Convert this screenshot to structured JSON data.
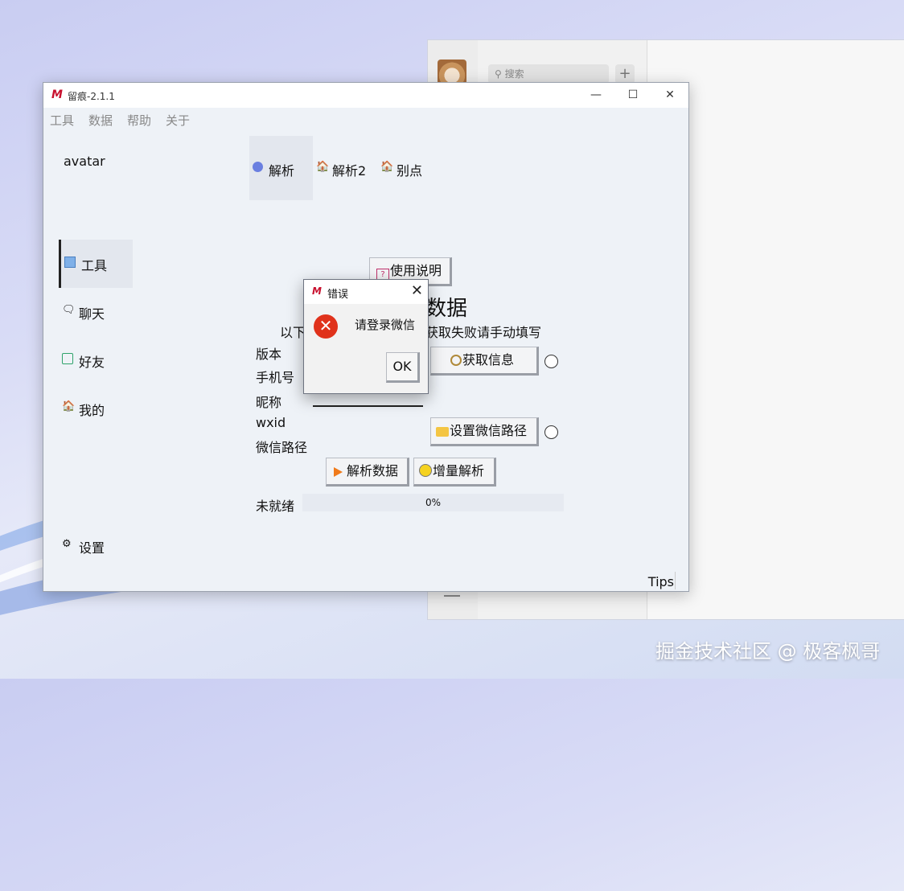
{
  "background_window": {
    "search_placeholder": "搜索",
    "add_label": "+"
  },
  "app": {
    "title": "留痕-2.1.1",
    "logo_letter": "M",
    "window_controls": {
      "minimize": "—",
      "maximize": "☐",
      "close": "✕"
    },
    "menu": [
      "工具",
      "数据",
      "帮助",
      "关于"
    ],
    "avatar_text": "avatar",
    "nav": [
      {
        "label": "工具",
        "icon": "toolbox-icon",
        "active": true
      },
      {
        "label": "聊天",
        "icon": "chat-bubble-icon",
        "active": false
      },
      {
        "label": "好友",
        "icon": "contact-icon",
        "active": false
      },
      {
        "label": "我的",
        "icon": "house-icon",
        "active": false
      },
      {
        "label": "设置",
        "icon": "gear-icon",
        "active": false
      }
    ],
    "tabs": [
      {
        "label": "解析",
        "icon": "blue-dot-icon",
        "active": true
      },
      {
        "label": "解析2",
        "icon": "house-icon",
        "active": false
      },
      {
        "label": "别点",
        "icon": "house-icon",
        "active": false
      }
    ],
    "help_button": "使用说明",
    "partial_heading": "数据",
    "partial_info_left": "以下",
    "partial_info_right": "获取失败请手动填写",
    "fields": [
      "版本",
      "手机号",
      "昵称",
      "wxid",
      "微信路径"
    ],
    "get_info_button": "获取信息",
    "set_path_button": "设置微信路径",
    "parse_button": "解析数据",
    "incremental_button": "增量解析",
    "status": "未就绪",
    "progress_text": "0%",
    "progress_value": 0,
    "tips": "Tips"
  },
  "dialog": {
    "title": "错误",
    "message": "请登录微信",
    "ok": "OK",
    "close": "✕",
    "error_glyph": "✕"
  },
  "watermark": "掘金技术社区 @ 极客枫哥",
  "colors": {
    "accent_red": "#c8102e",
    "error": "#e0321b",
    "window_bg": "#eef2f7"
  }
}
